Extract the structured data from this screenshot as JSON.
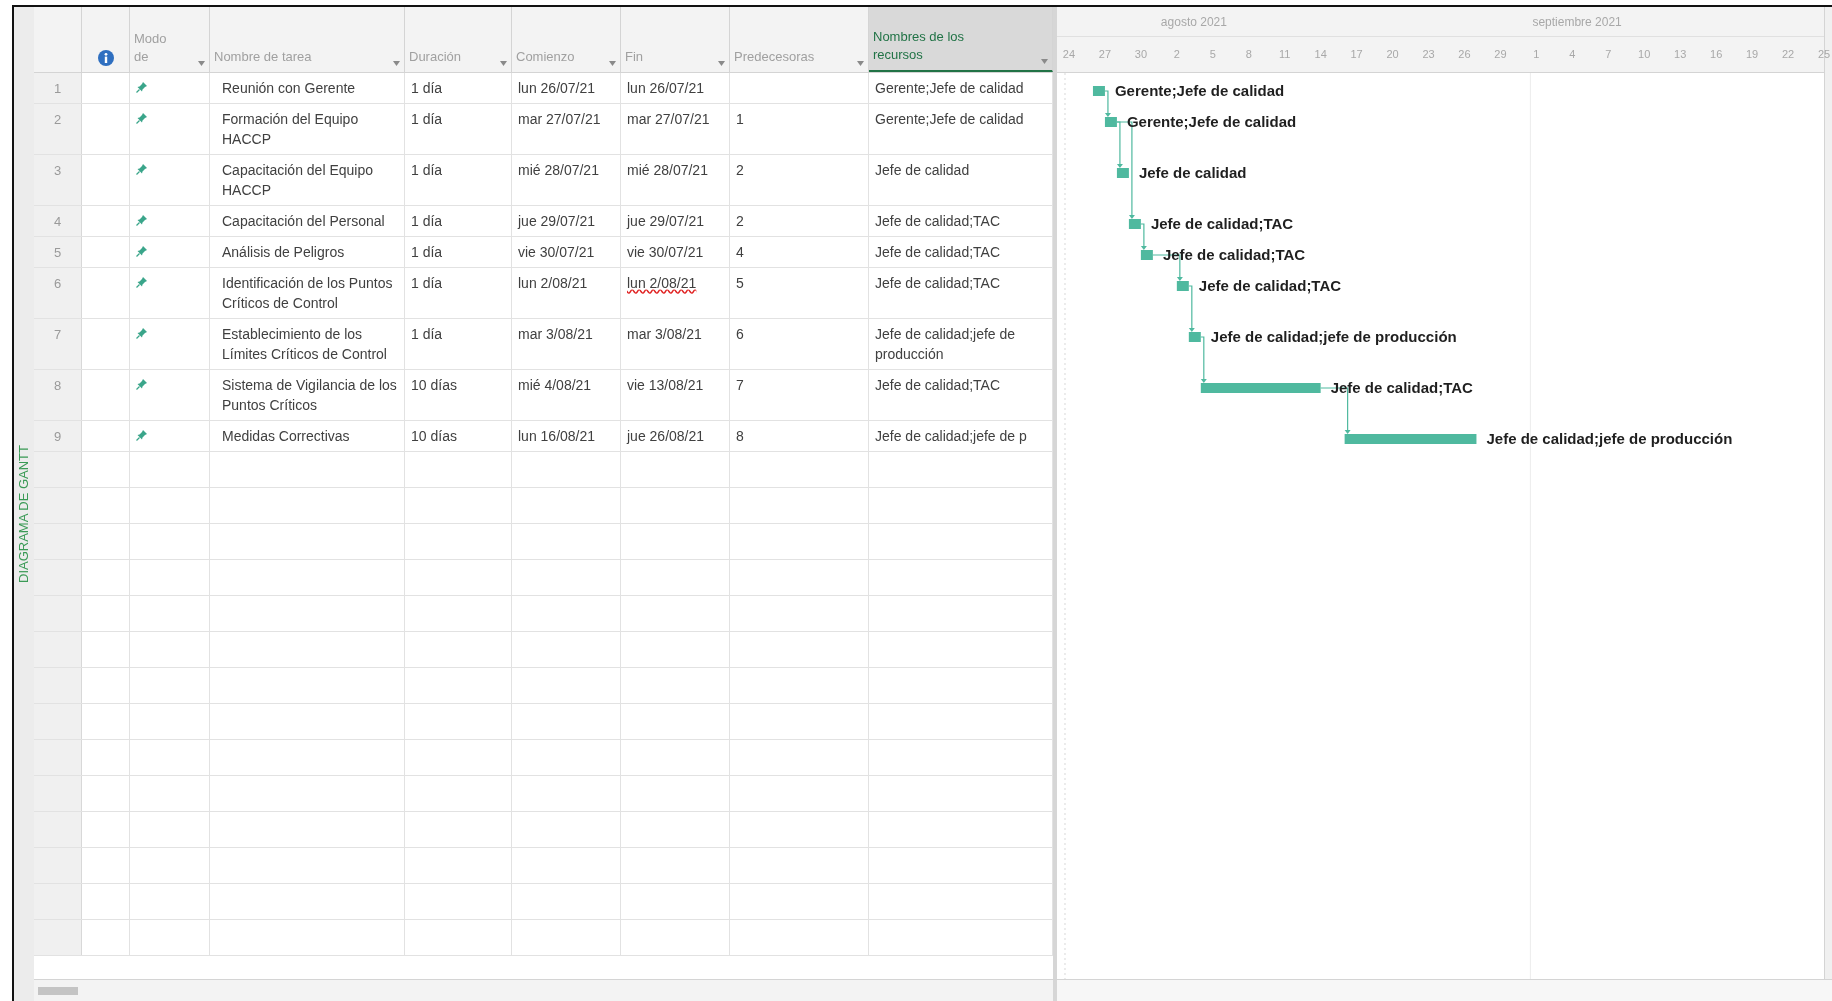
{
  "side_label": "DIAGRAMA DE GANTT",
  "columns": [
    {
      "kind": "info",
      "selected": false
    },
    {
      "kind": "mode",
      "label": "Modo de",
      "selected": false
    },
    {
      "kind": "name",
      "label": "Nombre de tarea",
      "selected": false
    },
    {
      "kind": "duration",
      "label": "Duración",
      "selected": false
    },
    {
      "kind": "start",
      "label": "Comienzo",
      "selected": false
    },
    {
      "kind": "finish",
      "label": "Fin",
      "selected": false
    },
    {
      "kind": "predecessors",
      "label": "Predecesoras",
      "selected": false
    },
    {
      "kind": "resources",
      "label": "Nombres de los recursos",
      "selected": true
    }
  ],
  "tasks": [
    {
      "id": "1",
      "name": "Reunión con Gerente",
      "duration": "1 día",
      "start": "lun 26/07/21",
      "finish": "lun 26/07/21",
      "resources": "Gerente;Jefe de calidad",
      "finish_flagged": false,
      "bar_label": "Gerente;Jefe de calidad"
    },
    {
      "id": "2",
      "name": "Formación del Equipo HACCP",
      "duration": "1 día",
      "start": "mar 27/07/21",
      "finish": "mar 27/07/21",
      "predecessors": "1",
      "resources": "Gerente;Jefe de calidad",
      "finish_flagged": false,
      "bar_label": "Gerente;Jefe de calidad"
    },
    {
      "id": "3",
      "name": "Capacitación del Equipo HACCP",
      "duration": "1 día",
      "start": "mié 28/07/21",
      "finish": "mié 28/07/21",
      "predecessors": "2",
      "resources": "Jefe de calidad",
      "finish_flagged": false,
      "bar_label": "Jefe de calidad"
    },
    {
      "id": "4",
      "name": "Capacitación del Personal",
      "duration": "1 día",
      "start": "jue 29/07/21",
      "finish": "jue 29/07/21",
      "predecessors": "2",
      "resources": "Jefe de calidad;TAC",
      "finish_flagged": false,
      "bar_label": "Jefe de calidad;TAC"
    },
    {
      "id": "5",
      "name": "Análisis de Peligros",
      "duration": "1 día",
      "start": "vie 30/07/21",
      "finish": "vie 30/07/21",
      "predecessors": "4",
      "resources": "Jefe de calidad;TAC",
      "finish_flagged": false,
      "bar_label": "Jefe de calidad;TAC"
    },
    {
      "id": "6",
      "name": "Identificación de los Puntos Críticos de Control",
      "duration": "1 día",
      "start": "lun 2/08/21",
      "finish": "lun 2/08/21",
      "predecessors": "5",
      "resources": "Jefe de calidad;TAC",
      "finish_flagged": true,
      "bar_label": "Jefe de calidad;TAC"
    },
    {
      "id": "7",
      "name": "Establecimiento de los Límites Críticos de Control",
      "duration": "1 día",
      "start": "mar 3/08/21",
      "finish": "mar 3/08/21",
      "predecessors": "6",
      "resources": "Jefe de calidad;jefe de producción",
      "finish_flagged": false,
      "bar_label": "Jefe de calidad;jefe de producción"
    },
    {
      "id": "8",
      "name": "Sistema de Vigilancia de los Puntos Críticos",
      "duration": "10 días",
      "start": "mié 4/08/21",
      "finish": "vie 13/08/21",
      "predecessors": "7",
      "resources": "Jefe de calidad;TAC",
      "finish_flagged": false,
      "bar_label": "Jefe de calidad;TAC"
    },
    {
      "id": "9",
      "name": "Medidas Correctivas",
      "duration": "10 días",
      "start": "lun 16/08/21",
      "finish": "jue 26/08/21",
      "predecessors": "8",
      "resources": "Jefe de calidad;jefe de p",
      "finish_flagged": false,
      "bar_label": "Jefe de calidad;jefe de producción"
    }
  ],
  "gantt": {
    "months": [
      "agosto 2021",
      "septiembre 2021"
    ],
    "days": [
      "24",
      "27",
      "30",
      "2",
      "5",
      "8",
      "11",
      "14",
      "17",
      "20",
      "23",
      "26",
      "29",
      "1",
      "4",
      "7",
      "10",
      "13",
      "16",
      "19",
      "22",
      "25"
    ]
  }
}
